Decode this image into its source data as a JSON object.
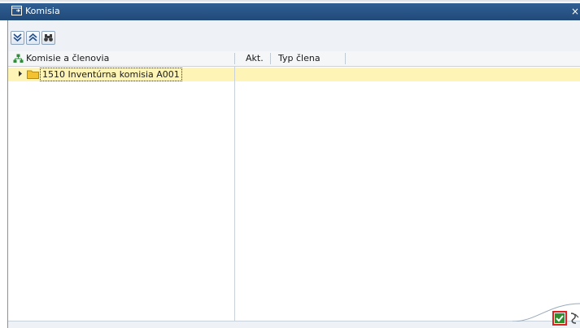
{
  "window": {
    "title": "Komisia",
    "icon": "window-icon",
    "close_glyph": "×"
  },
  "toolbar": {
    "buttons": [
      {
        "name": "expand-all-button",
        "icon": "expand-all-icon"
      },
      {
        "name": "collapse-all-button",
        "icon": "collapse-all-icon"
      },
      {
        "name": "find-button",
        "icon": "binoculars-icon"
      }
    ]
  },
  "table": {
    "columns": {
      "tree": "Komisie a členovia",
      "active": "Akt.",
      "member_type": "Typ člena"
    },
    "rows": [
      {
        "label": "1510 Inventúrna komisia A001",
        "active": "",
        "member_type": "",
        "selected": true,
        "expanded": false
      }
    ]
  },
  "footer": {
    "confirm_icon": "checkmark-icon",
    "cancel_icon": "cancel-icon"
  },
  "colors": {
    "title_bar": "#2a5585",
    "selected_row": "#fdf4b6",
    "folder": "#f2c230",
    "confirm_border": "#e02020"
  }
}
